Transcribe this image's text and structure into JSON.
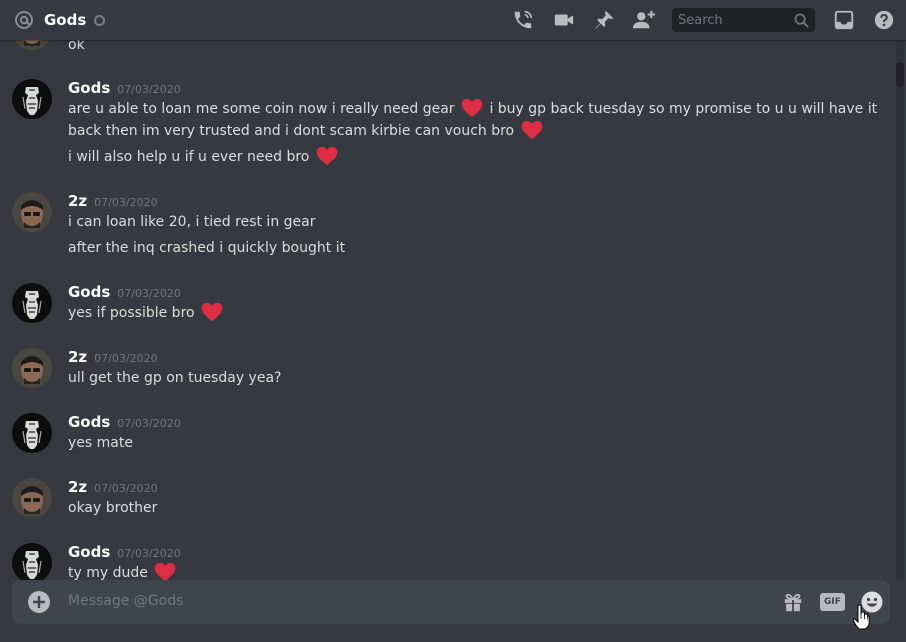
{
  "header": {
    "title": "Gods",
    "search_placeholder": "Search"
  },
  "messages": {
    "cut_off_line": "ok",
    "groups": [
      {
        "author": "Gods",
        "timestamp": "07/03/2020",
        "lines": [
          "are u able to loan me some coin now i really need gear",
          "i buy gp back tuesday so my promise to u u will have it",
          "back then im very trusted and i dont scam kirbie can vouch bro",
          "i will also help u if u ever need bro"
        ]
      },
      {
        "author": "2z",
        "timestamp": "07/03/2020",
        "lines": [
          "i can loan like 20, i tied rest in gear",
          "after the inq crashed i quickly bought it"
        ]
      },
      {
        "author": "Gods",
        "timestamp": "07/03/2020",
        "lines": [
          "yes if possible bro"
        ]
      },
      {
        "author": "2z",
        "timestamp": "07/03/2020",
        "lines": [
          "ull get the gp on tuesday yea?"
        ]
      },
      {
        "author": "Gods",
        "timestamp": "07/03/2020",
        "lines": [
          "yes mate"
        ]
      },
      {
        "author": "2z",
        "timestamp": "07/03/2020",
        "lines": [
          "okay brother"
        ]
      },
      {
        "author": "Gods",
        "timestamp": "07/03/2020",
        "lines": [
          "ty my dude"
        ]
      }
    ]
  },
  "composer": {
    "placeholder": "Message @Gods",
    "gif_label": "GIF"
  },
  "colors": {
    "background": "#36393f",
    "header_text": "#ffffff",
    "timestamp": "#72767d",
    "message_text": "#dcddde",
    "heart": "#dd2e44",
    "input_bg": "#40444b"
  },
  "icons": [
    "at-icon",
    "status-icon",
    "call-icon",
    "video-icon",
    "pin-icon",
    "add-friend-icon",
    "search-icon",
    "inbox-icon",
    "help-icon",
    "add-attachment-icon",
    "gift-icon",
    "gif-icon",
    "emoji-icon",
    "heart-emoji-icon",
    "hand-cursor-icon"
  ]
}
